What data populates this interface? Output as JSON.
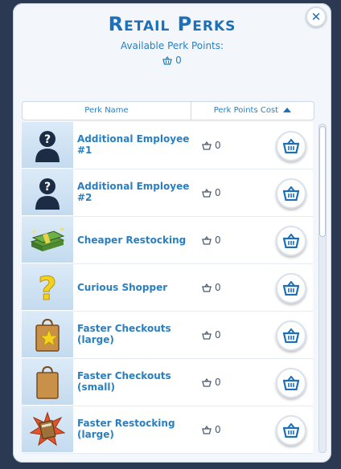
{
  "window": {
    "title": "Retail Perks",
    "close_label": "✕",
    "available_label": "Available Perk Points:",
    "available_points": "0"
  },
  "table": {
    "col_name": "Perk Name",
    "col_cost": "Perk Points Cost"
  },
  "perks": [
    {
      "name": "Additional Employee #1",
      "cost": "0",
      "icon": "silhouette-question-icon"
    },
    {
      "name": "Additional Employee #2",
      "cost": "0",
      "icon": "silhouette-question-icon"
    },
    {
      "name": "Cheaper Restocking",
      "cost": "0",
      "icon": "money-stack-icon"
    },
    {
      "name": "Curious Shopper",
      "cost": "0",
      "icon": "question-mark-icon"
    },
    {
      "name": "Faster Checkouts (large)",
      "cost": "0",
      "icon": "shopping-bag-star-icon"
    },
    {
      "name": "Faster Checkouts (small)",
      "cost": "0",
      "icon": "shopping-bag-icon"
    },
    {
      "name": "Faster Restocking (large)",
      "cost": "0",
      "icon": "box-burst-icon"
    }
  ],
  "colors": {
    "accent": "#1d6fb8",
    "text_blue": "#2a7fc1",
    "background": "#2b3a52"
  }
}
